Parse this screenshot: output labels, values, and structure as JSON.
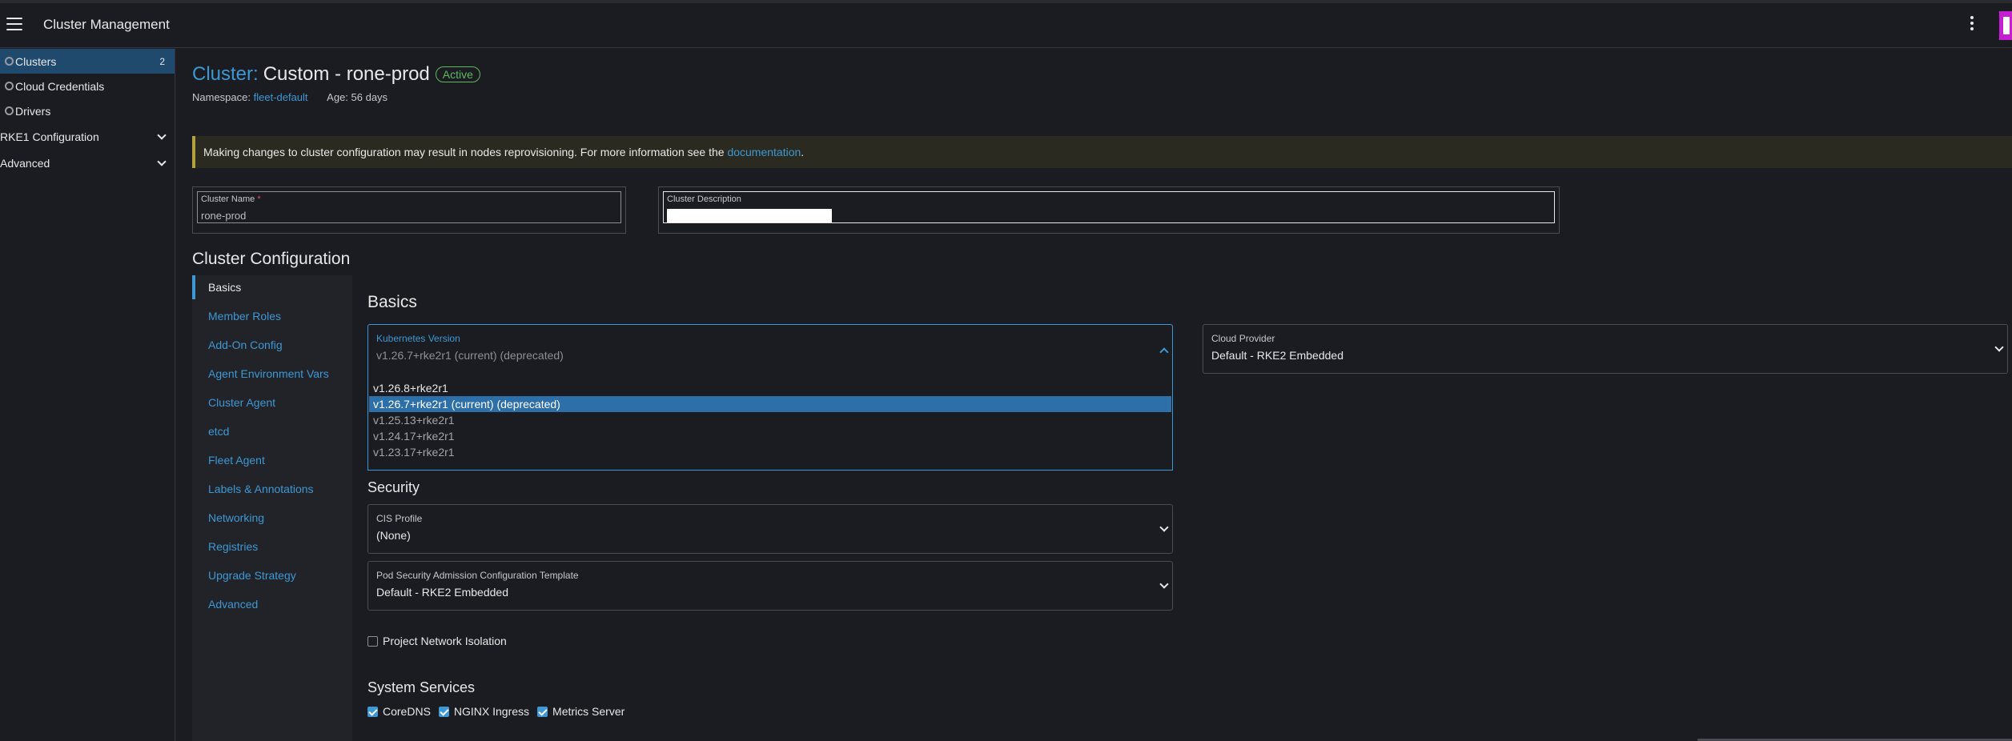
{
  "header": {
    "title": "Cluster Management"
  },
  "sidebar": {
    "items": [
      {
        "label": "Clusters",
        "count": "2"
      },
      {
        "label": "Cloud Credentials"
      },
      {
        "label": "Drivers"
      }
    ],
    "groups": [
      {
        "label": "RKE1 Configuration"
      },
      {
        "label": "Advanced"
      }
    ]
  },
  "page": {
    "kind": "Cluster:",
    "name": "Custom - rone-prod",
    "status": "Active",
    "namespace_label": "Namespace:",
    "namespace_value": "fleet-default",
    "age": "Age: 56 days"
  },
  "banner": {
    "text": "Making changes to cluster configuration may result in nodes reprovisioning. For more information see the",
    "link": "documentation",
    "suffix": "."
  },
  "form": {
    "cluster_name_label": "Cluster Name",
    "required_mark": "*",
    "cluster_name_value": "rone-prod",
    "cluster_description_label": "Cluster Description"
  },
  "config": {
    "heading": "Cluster Configuration",
    "tabs": [
      "Basics",
      "Member Roles",
      "Add-On Config",
      "Agent Environment Vars",
      "Cluster Agent",
      "etcd",
      "Fleet Agent",
      "Labels & Annotations",
      "Networking",
      "Registries",
      "Upgrade Strategy",
      "Advanced"
    ]
  },
  "basics": {
    "heading": "Basics",
    "k8s_label": "Kubernetes Version",
    "k8s_value": "v1.26.7+rke2r1 (current) (deprecated)",
    "k8s_options": [
      "v1.26.8+rke2r1",
      "v1.26.7+rke2r1 (current) (deprecated)",
      "v1.25.13+rke2r1",
      "v1.24.17+rke2r1",
      "v1.23.17+rke2r1"
    ],
    "cloud_label": "Cloud Provider",
    "cloud_value": "Default - RKE2 Embedded"
  },
  "security": {
    "heading": "Security",
    "cis_label": "CIS Profile",
    "cis_value": "(None)",
    "psa_label": "Pod Security Admission Configuration Template",
    "psa_value": "Default - RKE2 Embedded",
    "isolation_label": "Project Network Isolation"
  },
  "services": {
    "heading": "System Services",
    "items": [
      "CoreDNS",
      "NGINX Ingress",
      "Metrics Server"
    ]
  },
  "colors": {
    "accent": "#3d98d3",
    "active": "#5fb95f",
    "warning": "#b3a13d",
    "selected": "#2d6fa8"
  },
  "icons": [
    "hamburger-icon",
    "kebab-menu-icon",
    "cluster-icon",
    "chevron-down-icon",
    "chevron-up-icon",
    "checkbox-icon"
  ]
}
